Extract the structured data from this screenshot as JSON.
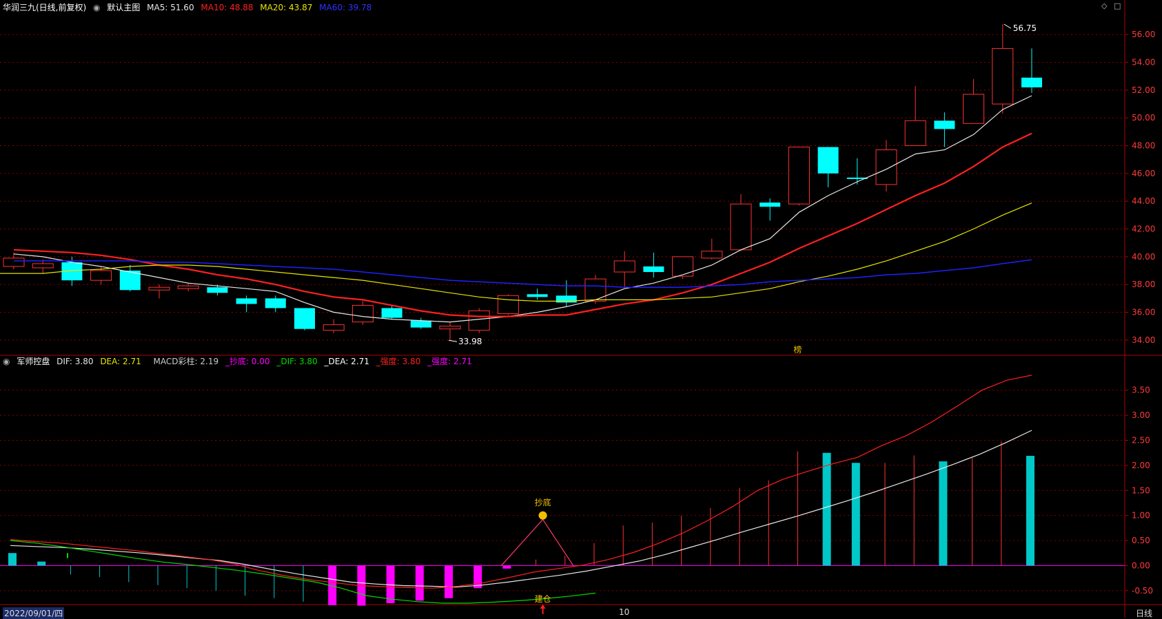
{
  "header": {
    "stock_title": "华润三九(日线,前复权)",
    "main_chart_label": "默认主图",
    "ma5": "MA5: 51.60",
    "ma10": "MA10: 48.88",
    "ma20": "MA20: 43.87",
    "ma60": "MA60: 39.78",
    "icons": [
      "circle-menu-icon",
      "diamond-icon",
      "square-icon"
    ]
  },
  "indicator_header": {
    "name": "军师控盘",
    "dif": "DIF: 3.80",
    "dea": "DEA: 2.71",
    "macd": "MACD彩柱: 2.19",
    "chaodi": "_抄底: 0.00",
    "dif2": "_DIF: 3.80",
    "dea2": "_DEA: 2.71",
    "qiangdu1": "_强度: 3.80",
    "qiangdu2": "_强度: 2.71"
  },
  "x_axis": {
    "start_date": "2022/09/01/四",
    "mid_label": "10",
    "period": "日线"
  },
  "annotations": {
    "high_label": "56.75",
    "low_label": "33.98",
    "bang": "榜",
    "chaodi": "抄底",
    "jiancang": "建仓"
  },
  "colors": {
    "up": "#ff3232",
    "down": "#00ffff",
    "ma5": "#e8e8e8",
    "ma10": "#ff2020",
    "ma20": "#e6e600",
    "ma60": "#2020ff",
    "dif": "#e8e8e8",
    "dea": "#ff2020",
    "green": "#00dd00",
    "magenta": "#ff00ff",
    "teal": "#00c8c8",
    "grid": "#8b0000"
  },
  "chart_data": [
    {
      "type": "candlestick",
      "title": "华润三九(日线,前复权)",
      "ylim": [
        33,
        57.5
      ],
      "yticks": [
        "34.00",
        "36.00",
        "38.00",
        "40.00",
        "42.00",
        "44.00",
        "46.00",
        "48.00",
        "50.00",
        "52.00",
        "54.00",
        "56.00"
      ],
      "candles": [
        {
          "o": 39.3,
          "c": 39.9,
          "h": 40.3,
          "l": 39.1
        },
        {
          "o": 39.2,
          "c": 39.5,
          "h": 39.8,
          "l": 38.8
        },
        {
          "o": 39.6,
          "c": 38.3,
          "h": 40.0,
          "l": 37.9
        },
        {
          "o": 38.3,
          "c": 39.0,
          "h": 39.3,
          "l": 38.0
        },
        {
          "o": 39.0,
          "c": 37.6,
          "h": 39.4,
          "l": 37.5
        },
        {
          "o": 37.6,
          "c": 37.8,
          "h": 38.0,
          "l": 37.0
        },
        {
          "o": 37.7,
          "c": 37.9,
          "h": 38.1,
          "l": 37.5
        },
        {
          "o": 37.8,
          "c": 37.4,
          "h": 38.0,
          "l": 37.2
        },
        {
          "o": 37.0,
          "c": 36.6,
          "h": 37.2,
          "l": 36.0
        },
        {
          "o": 37.0,
          "c": 36.3,
          "h": 37.2,
          "l": 36.0
        },
        {
          "o": 36.3,
          "c": 34.8,
          "h": 36.3,
          "l": 34.7
        },
        {
          "o": 34.7,
          "c": 35.1,
          "h": 35.5,
          "l": 34.5
        },
        {
          "o": 35.3,
          "c": 36.5,
          "h": 36.8,
          "l": 35.1
        },
        {
          "o": 36.3,
          "c": 35.6,
          "h": 36.5,
          "l": 35.5
        },
        {
          "o": 35.4,
          "c": 34.9,
          "h": 35.6,
          "l": 34.8
        },
        {
          "o": 34.8,
          "c": 35.0,
          "h": 35.3,
          "l": 33.98
        },
        {
          "o": 34.7,
          "c": 36.1,
          "h": 36.3,
          "l": 34.5
        },
        {
          "o": 35.9,
          "c": 37.2,
          "h": 37.3,
          "l": 35.8
        },
        {
          "o": 37.3,
          "c": 37.1,
          "h": 37.7,
          "l": 36.9
        },
        {
          "o": 37.2,
          "c": 36.7,
          "h": 38.3,
          "l": 36.4
        },
        {
          "o": 36.8,
          "c": 38.4,
          "h": 38.7,
          "l": 36.6
        },
        {
          "o": 38.9,
          "c": 39.7,
          "h": 40.4,
          "l": 37.8
        },
        {
          "o": 39.3,
          "c": 38.9,
          "h": 40.3,
          "l": 38.5
        },
        {
          "o": 38.6,
          "c": 40.0,
          "h": 40.0,
          "l": 38.4
        },
        {
          "o": 39.9,
          "c": 40.4,
          "h": 41.3,
          "l": 39.8
        },
        {
          "o": 40.5,
          "c": 43.8,
          "h": 44.5,
          "l": 40.4
        },
        {
          "o": 43.9,
          "c": 43.6,
          "h": 44.2,
          "l": 42.6
        },
        {
          "o": 43.8,
          "c": 47.9,
          "h": 47.9,
          "l": 43.7
        },
        {
          "o": 47.9,
          "c": 46.0,
          "h": 47.9,
          "l": 45.0
        },
        {
          "o": 45.7,
          "c": 45.6,
          "h": 47.1,
          "l": 45.2
        },
        {
          "o": 45.2,
          "c": 47.7,
          "h": 48.4,
          "l": 44.7
        },
        {
          "o": 48.0,
          "c": 49.8,
          "h": 52.3,
          "l": 48.0
        },
        {
          "o": 49.8,
          "c": 49.2,
          "h": 50.4,
          "l": 47.9
        },
        {
          "o": 49.6,
          "c": 51.7,
          "h": 52.8,
          "l": 49.6
        },
        {
          "o": 51.0,
          "c": 55.0,
          "h": 56.75,
          "l": 50.3
        },
        {
          "o": 52.9,
          "c": 52.2,
          "h": 55.0,
          "l": 51.8
        }
      ],
      "series": [
        {
          "name": "MA5",
          "values": [
            40.2,
            40.0,
            39.6,
            39.3,
            38.9,
            38.5,
            38.1,
            37.9,
            37.7,
            37.5,
            36.7,
            36.0,
            35.7,
            35.5,
            35.4,
            35.3,
            35.5,
            35.7,
            36.0,
            36.4,
            36.9,
            37.7,
            38.1,
            38.7,
            39.4,
            40.5,
            41.3,
            43.2,
            44.4,
            45.4,
            46.3,
            47.4,
            47.7,
            48.8,
            50.6,
            51.6
          ]
        },
        {
          "name": "MA10",
          "values": [
            40.5,
            40.4,
            40.3,
            40.1,
            39.8,
            39.4,
            39.1,
            38.7,
            38.4,
            38.0,
            37.5,
            37.1,
            36.9,
            36.5,
            36.1,
            35.8,
            35.7,
            35.7,
            35.8,
            35.8,
            36.2,
            36.6,
            36.9,
            37.4,
            38.0,
            38.8,
            39.6,
            40.6,
            41.5,
            42.4,
            43.4,
            44.4,
            45.3,
            46.5,
            47.9,
            48.88
          ]
        },
        {
          "name": "MA20",
          "values": [
            38.8,
            39.0,
            39.1,
            39.3,
            39.4,
            39.4,
            39.3,
            39.1,
            38.9,
            38.7,
            38.5,
            38.3,
            38.0,
            37.7,
            37.4,
            37.1,
            36.9,
            36.8,
            36.8,
            36.9,
            36.9,
            36.9,
            37.0,
            37.1,
            37.4,
            37.7,
            38.2,
            38.6,
            39.1,
            39.7,
            40.4,
            41.1,
            42.0,
            43.0,
            43.87
          ]
        },
        {
          "name": "MA60",
          "values": [
            39.7,
            39.7,
            39.7,
            39.7,
            39.7,
            39.6,
            39.6,
            39.5,
            39.4,
            39.3,
            39.2,
            39.1,
            38.9,
            38.7,
            38.5,
            38.3,
            38.2,
            38.1,
            38.0,
            37.9,
            37.9,
            37.8,
            37.8,
            37.8,
            37.9,
            38.0,
            38.2,
            38.3,
            38.4,
            38.5,
            38.7,
            38.8,
            39.0,
            39.2,
            39.5,
            39.78
          ]
        }
      ]
    },
    {
      "type": "bar",
      "title": "军师控盘",
      "ylim": [
        -0.75,
        3.95
      ],
      "yticks": [
        "-0.50",
        "0.00",
        "0.50",
        "1.00",
        "1.50",
        "2.00",
        "2.50",
        "3.00",
        "3.50"
      ],
      "series": [
        {
          "name": "DIF",
          "values": [
            0.4,
            0.38,
            0.36,
            0.33,
            0.29,
            0.25,
            0.2,
            0.15,
            0.1,
            0.02,
            -0.08,
            -0.17,
            -0.25,
            -0.33,
            -0.37,
            -0.4,
            -0.41,
            -0.43,
            -0.39,
            -0.33,
            -0.26,
            -0.19,
            -0.11,
            -0.01,
            0.09,
            0.22,
            0.37,
            0.52,
            0.68,
            0.83,
            0.98,
            1.14,
            1.3,
            1.47,
            1.65,
            1.83,
            2.02,
            2.22,
            2.45,
            2.7
          ]
        },
        {
          "name": "DEA",
          "values": [
            0.52,
            0.48,
            0.45,
            0.4,
            0.35,
            0.3,
            0.24,
            0.18,
            0.12,
            0.03,
            -0.1,
            -0.2,
            -0.28,
            -0.34,
            -0.4,
            -0.42,
            -0.44,
            -0.45,
            -0.41,
            -0.34,
            -0.24,
            -0.13,
            -0.06,
            0.01,
            0.12,
            0.26,
            0.44,
            0.65,
            0.9,
            1.18,
            1.5,
            1.72,
            1.88,
            2.03,
            2.16,
            2.4,
            2.6,
            2.87,
            3.18,
            3.5,
            3.7,
            3.8
          ]
        },
        {
          "name": "green",
          "values": [
            0.5,
            0.45,
            0.38,
            0.3,
            0.22,
            0.14,
            0.07,
            0.02,
            -0.04,
            -0.1,
            -0.17,
            -0.25,
            -0.33,
            -0.45,
            -0.6,
            -0.67,
            -0.72,
            -0.75,
            -0.75,
            -0.73,
            -0.7,
            -0.66,
            -0.61,
            -0.55
          ]
        },
        {
          "name": "MACD",
          "values": [
            0.25,
            0.08,
            -0.18,
            -0.23,
            -0.33,
            -0.39,
            -0.45,
            -0.5,
            -0.6,
            -0.65,
            -0.72,
            -0.79,
            -0.8,
            -0.75,
            -0.7,
            -0.65,
            -0.45,
            -0.06,
            0.12,
            0.2,
            0.45,
            0.8,
            0.86,
            1.0,
            1.15,
            1.55,
            1.7,
            2.28,
            2.25,
            2.05,
            2.05,
            2.2,
            2.08,
            2.15,
            2.48,
            2.19
          ]
        }
      ]
    }
  ]
}
